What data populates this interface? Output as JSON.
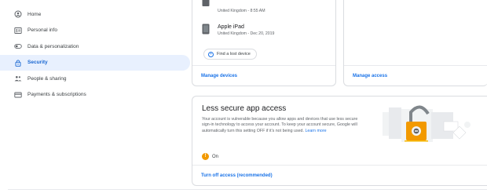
{
  "sidebar": {
    "items": [
      {
        "label": "Home",
        "icon": "home-icon"
      },
      {
        "label": "Personal info",
        "icon": "id-card-icon"
      },
      {
        "label": "Data & personalization",
        "icon": "toggle-icon"
      },
      {
        "label": "Security",
        "icon": "lock-icon",
        "active": true
      },
      {
        "label": "People & sharing",
        "icon": "people-icon"
      },
      {
        "label": "Payments & subscriptions",
        "icon": "credit-card-icon"
      }
    ]
  },
  "devices": {
    "device1_meta": "United Kingdom - 8:55 AM",
    "device2_name": "Apple iPad",
    "device2_meta": "United Kingdom - Dec 20, 2019",
    "find_button": "Find a lost device",
    "manage_link": "Manage devices"
  },
  "access": {
    "manage_link": "Manage access"
  },
  "less_secure": {
    "title": "Less secure app access",
    "description": "Your account is vulnerable because you allow apps and devices that use less secure sign-in technology to access your account. To keep your account secure, Google will automatically turn this setting OFF if it's not being used.",
    "learn_more": "Learn more",
    "status": "On",
    "turn_off_link": "Turn off access (recommended)"
  },
  "colors": {
    "accent": "#1a73e8",
    "active_bg": "#e8f0fe",
    "warning": "#f29900"
  }
}
